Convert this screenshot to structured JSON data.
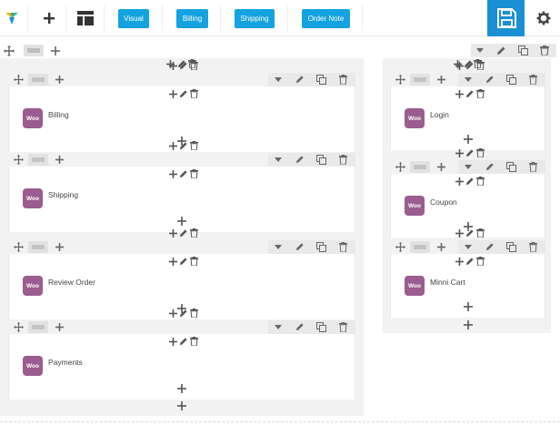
{
  "toolbar": {
    "logo_icon": "vc-logo-icon",
    "add_icon": "plus-icon",
    "layout_icon": "layout-template-icon",
    "tabs": [
      {
        "label": "Visual"
      },
      {
        "label": "Billing"
      },
      {
        "label": "Shipping"
      },
      {
        "label": "Order Note"
      }
    ],
    "save_icon": "floppy-disk-icon",
    "settings_icon": "gear-icon"
  },
  "colors": {
    "accent": "#14a3e0",
    "save_bg": "#1b8fd3",
    "woo_purple": "#9b5c8f",
    "row_bg": "#f2f2f2"
  },
  "left_column": {
    "elements": [
      {
        "badge": "Woo",
        "label": "Billing"
      },
      {
        "badge": "Woo",
        "label": "Shipping"
      },
      {
        "badge": "Woo",
        "label": "Review Order"
      },
      {
        "badge": "Woo",
        "label": "Payments"
      }
    ]
  },
  "right_column": {
    "elements": [
      {
        "badge": "Woo",
        "label": "Login"
      },
      {
        "badge": "Woo",
        "label": "Coupon"
      },
      {
        "badge": "Woo",
        "label": "Minni Cart"
      }
    ]
  }
}
